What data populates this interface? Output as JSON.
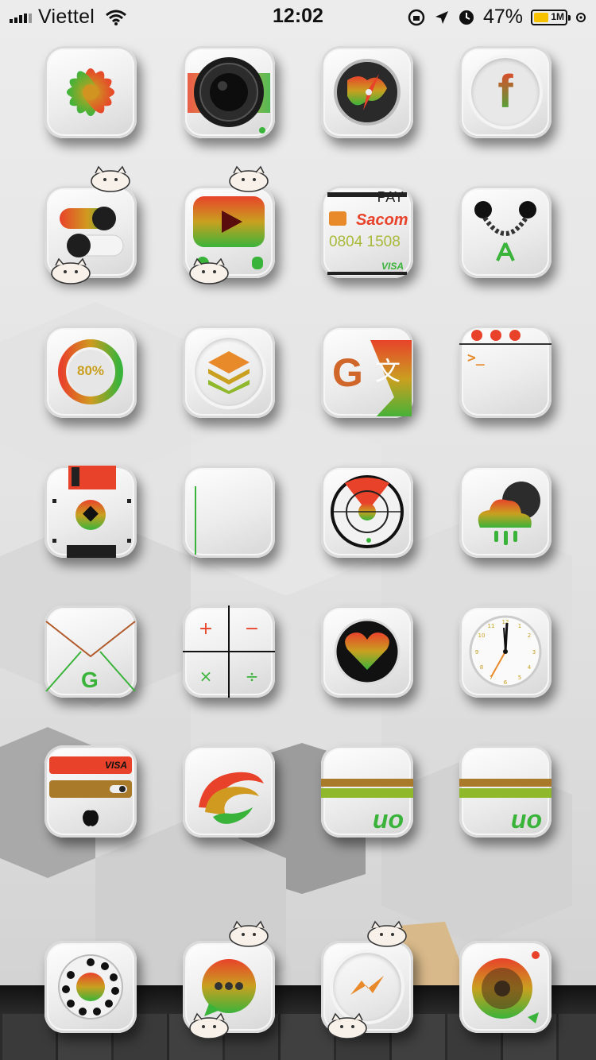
{
  "status_bar": {
    "carrier": "Viettel",
    "time": "12:02",
    "battery_percent": "47%",
    "battery_label": "1M",
    "battery_level": 0.47
  },
  "icons": {
    "flower": "flower-icon",
    "camera": "camera-icon",
    "safari": "compass-icon",
    "facebook": "facebook-icon",
    "settings": "toggle-settings-icon",
    "youtube": "youtube-icon",
    "pay": "pay-card-icon",
    "cydia": "headphones-icon",
    "battery": "battery-ring-icon",
    "layers": "layers-icon",
    "translate": "translate-icon",
    "terminal": "terminal-icon",
    "floppy": "floppy-disk-icon",
    "notes": "notes-icon",
    "radar": "radar-icon",
    "weather": "weather-icon",
    "mail": "mail-icon",
    "calculator": "calculator-icon",
    "health": "heart-icon",
    "clock": "clock-icon",
    "wallet": "wallet-icon",
    "swirl": "swirl-icon",
    "uo1": "uo-app-icon",
    "uo2": "uo-app-icon",
    "phone": "rotary-phone-icon",
    "messages": "messages-icon",
    "messenger": "messenger-icon",
    "music": "speaker-icon"
  },
  "text": {
    "facebook_letter": "f",
    "pay_label": "PAY",
    "pay_bank": "Sacom",
    "pay_number": "0804 1508",
    "pay_visa": "VISA",
    "battery_ring_label": "80%",
    "terminal_prompt": ">_",
    "wallet_visa": "VISA",
    "uo_label": "uo",
    "mail_letter": "G",
    "google_letter": "G"
  },
  "colors": {
    "accent_red": "#e8432a",
    "accent_orange": "#e98a2a",
    "accent_green": "#3ab33a",
    "icon_bg": "#ececec"
  }
}
